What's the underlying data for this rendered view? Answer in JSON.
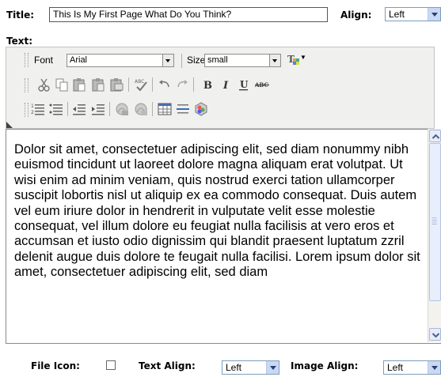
{
  "form": {
    "title_label": "Title:",
    "title_value": "This Is My First Page What Do You Think?",
    "align_label": "Align:",
    "align_value": "Left",
    "text_label": "Text:"
  },
  "toolbar": {
    "font_label": "Font",
    "font_value": "Arial",
    "size_label": "Size",
    "size_value": "small",
    "icons_row2": [
      "cut-icon",
      "copy-icon",
      "paste-icon",
      "paste-text-icon",
      "paste-word-icon",
      "spellcheck-icon",
      "undo-icon",
      "redo-icon",
      "bold-icon",
      "italic-icon",
      "underline-icon",
      "strikethrough-icon"
    ],
    "icons_row3": [
      "ordered-list-icon",
      "unordered-list-icon",
      "outdent-icon",
      "indent-icon",
      "link-icon",
      "unlink-icon",
      "table-icon",
      "horizontal-rule-icon",
      "image-icon"
    ]
  },
  "editor": {
    "content": "Dolor sit amet, consectetuer adipiscing elit, sed diam nonummy nibh euismod tincidunt ut laoreet dolore magna aliquam erat volutpat. Ut wisi enim ad minim veniam, quis nostrud exerci tation ullamcorper suscipit lobortis nisl ut aliquip ex ea commodo consequat. Duis autem vel eum iriure dolor in hendrerit in vulputate velit esse molestie consequat, vel illum dolore eu feugiat nulla facilisis at vero eros et accumsan et iusto odio dignissim qui blandit praesent luptatum zzril delenit augue duis dolore te feugait nulla facilisi. Lorem ipsum dolor sit amet, consectetuer adipiscing elit, sed diam"
  },
  "bottom": {
    "file_icon_label": "File Icon:",
    "file_icon_checked": false,
    "text_align_label": "Text Align:",
    "text_align_value": "Left",
    "image_align_label": "Image Align:",
    "image_align_value": "Left"
  },
  "colors": {
    "toolbar_bg": "#f0f0ee",
    "select_arrow_bg": "#c9d8f5"
  }
}
